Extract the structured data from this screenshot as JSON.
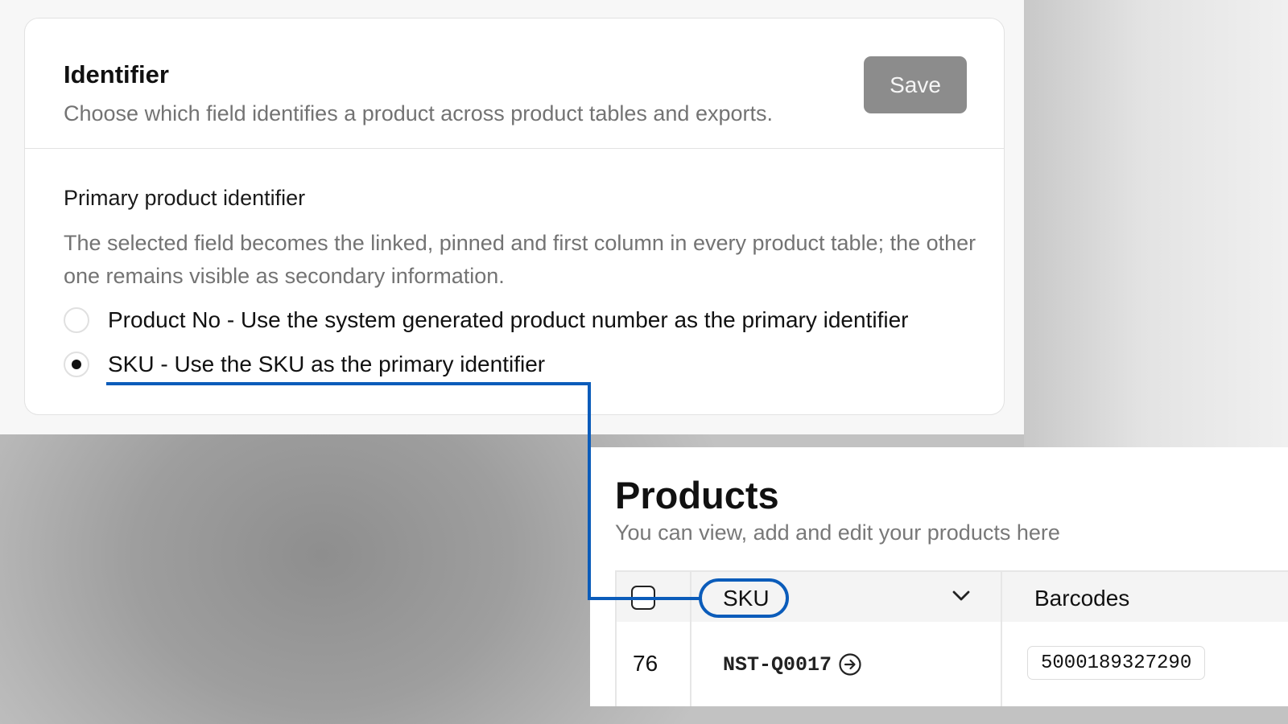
{
  "identifier_card": {
    "title": "Identifier",
    "subtitle": "Choose which field identifies a product across product tables and exports.",
    "save_label": "Save",
    "section_title": "Primary product identifier",
    "section_description": "The selected field becomes the linked, pinned and first column in every product table; the other one remains visible as secondary information.",
    "options": [
      {
        "label": "Product No - Use the system generated product number as the primary identifier",
        "selected": false
      },
      {
        "label": "SKU - Use the SKU as the primary identifier",
        "selected": true
      }
    ]
  },
  "products": {
    "title": "Products",
    "subtitle": "You can view, add and edit your products here",
    "columns": {
      "primary": "SKU",
      "secondary": "Barcodes"
    },
    "rows": [
      {
        "index": "76",
        "sku": "NST-Q0017",
        "barcode": "5000189327290"
      }
    ]
  },
  "icons": {
    "checkbox": "checkbox-icon",
    "sort": "chevron-down-icon",
    "open_link": "arrow-right-circle-icon"
  },
  "colors": {
    "highlight_blue": "#0b5cba",
    "save_button": "#8c8c8c",
    "muted_text": "#737373"
  }
}
